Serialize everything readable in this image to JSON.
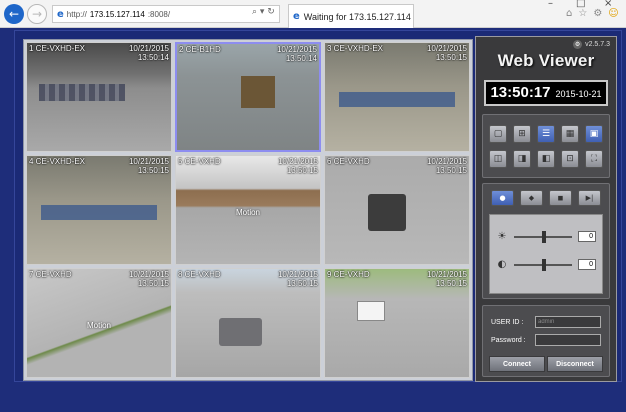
{
  "browser": {
    "url_scheme": "http://",
    "url_host": "173.15.127.114",
    "url_port": ":8008/",
    "tab_title": "Waiting for 173.15.127.114",
    "tab_close": "×",
    "minimize": "–",
    "restore": "□",
    "close": "×",
    "address_controls": "⌕ ▾ ↻",
    "toolbar_icons": [
      "⌂",
      "☆",
      "⚙",
      "☺"
    ]
  },
  "cameras": [
    {
      "name": "1 CE-VXHD-EX",
      "date": "10/21/2015",
      "time": "13:50:14",
      "motion": ""
    },
    {
      "name": "2 CE-B1HD",
      "date": "10/21/2015",
      "time": "13:50:14",
      "motion": ""
    },
    {
      "name": "3 CE-VXHD-EX",
      "date": "10/21/2015",
      "time": "13:50:15",
      "motion": ""
    },
    {
      "name": "4 CE-VXHD-EX",
      "date": "10/21/2015",
      "time": "13:50:15",
      "motion": ""
    },
    {
      "name": "5 CE-VXHD",
      "date": "10/21/2015",
      "time": "13:50:15",
      "motion": "Motion"
    },
    {
      "name": "6 CE-VXHD",
      "date": "10/21/2015",
      "time": "13:50:15",
      "motion": ""
    },
    {
      "name": "7 CE-VXHD",
      "date": "10/21/2015",
      "time": "13:50:15",
      "motion": "Motion"
    },
    {
      "name": "8 CE-VXHD",
      "date": "10/21/2015",
      "time": "13:50:15",
      "motion": ""
    },
    {
      "name": "9 CE-VXHD",
      "date": "10/21/2015",
      "time": "13:50:15",
      "motion": ""
    }
  ],
  "panel": {
    "version": "v2.5.7.3",
    "title": "Web Viewer",
    "clock_time": "13:50:17",
    "clock_date": "2015-10-21",
    "layout_buttons": [
      "▢",
      "⊞",
      "☰",
      "▦",
      "▣",
      "◫",
      "◨",
      "◧",
      "⊡",
      "⛶"
    ],
    "playback_buttons": [
      "●",
      "◆",
      "◼",
      "▶|"
    ],
    "brightness_value": "0",
    "contrast_value": "0",
    "user_id_label": "USER ID :",
    "user_id_placeholder": "admin",
    "password_label": "Password :",
    "connect": "Connect",
    "disconnect": "Disconnect"
  },
  "colors": {
    "page_background": "#1e2d7a",
    "panel_background": "#3a3a3c",
    "selected_camera_border": "#8d8df0",
    "active_button": "#3f5fb3"
  }
}
